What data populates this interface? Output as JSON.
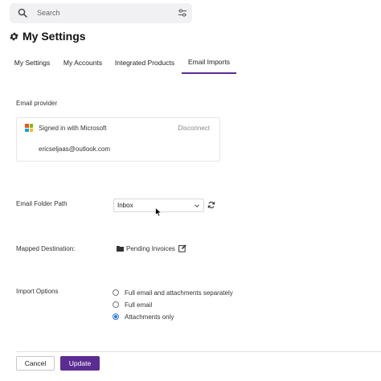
{
  "search": {
    "placeholder": "Search"
  },
  "header": {
    "title": "My Settings"
  },
  "tabs": [
    {
      "label": "My Settings"
    },
    {
      "label": "My Accounts"
    },
    {
      "label": "Integrated Products"
    },
    {
      "label": "Email Imports",
      "active": true
    }
  ],
  "email_provider": {
    "label": "Email provider",
    "provider_name": "Signed in with Microsoft",
    "disconnect_label": "Disconnect",
    "email": "ericseljaas@outlook.com",
    "logo_colors": [
      "#f25022",
      "#7fba00",
      "#00a4ef",
      "#ffb900"
    ]
  },
  "folder_path": {
    "label": "Email Folder Path",
    "value": "Inbox"
  },
  "mapped_destination": {
    "label": "Mapped Destination:",
    "value": "Pending Invoices"
  },
  "import_options": {
    "label": "Import Options",
    "options": [
      {
        "label": "Full email and attachments separately",
        "checked": false
      },
      {
        "label": "Full email",
        "checked": false
      },
      {
        "label": "Attachments only",
        "checked": true
      }
    ]
  },
  "footer": {
    "cancel_label": "Cancel",
    "update_label": "Update"
  },
  "colors": {
    "accent": "#5c2d91",
    "radio": "#2878d6"
  }
}
